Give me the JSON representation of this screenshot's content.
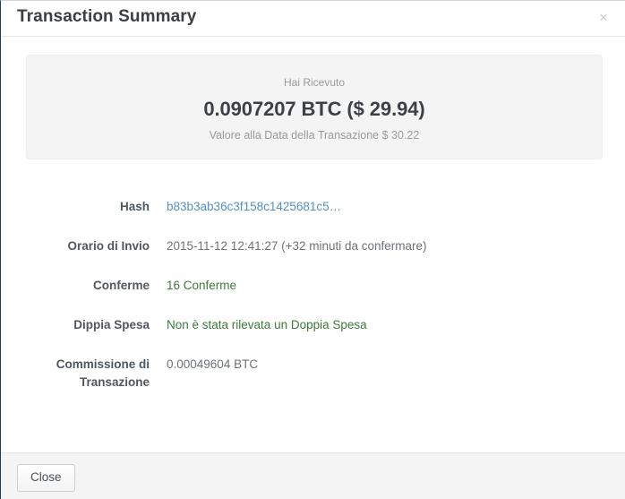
{
  "modal": {
    "title": "Transaction Summary",
    "close_icon": "close-icon",
    "close_icon_glyph": "×"
  },
  "summary": {
    "label": "Hai Ricevuto",
    "amount": "0.0907207 BTC ($ 29.94)",
    "value_at_date": "Valore alla Data della Transazione $ 30.22"
  },
  "details": [
    {
      "label": "Hash",
      "value": "b83b3ab36c3f158c1425681c5…",
      "style": "link"
    },
    {
      "label": "Orario di Invio",
      "value": "2015-11-12 12:41:27 (+32 minuti da confermare)",
      "style": "plain"
    },
    {
      "label": "Conferme",
      "value": "16 Conferme",
      "style": "ok"
    },
    {
      "label": "Dippia Spesa",
      "value": "Non è stata rilevata un Doppia Spesa",
      "style": "ok"
    },
    {
      "label": "Commissione di\nTransazione",
      "value": "0.00049604 BTC",
      "style": "plain"
    }
  ],
  "footer": {
    "close_button": "Close"
  },
  "colors": {
    "link": "#5491c4",
    "success": "#3d7a3b",
    "title": "#3a3f44",
    "label": "#50585f",
    "value": "#6d7277",
    "muted": "#9a9a9a",
    "panel_bg": "#f4f4f4",
    "footer_bg": "#f4f4f4"
  }
}
